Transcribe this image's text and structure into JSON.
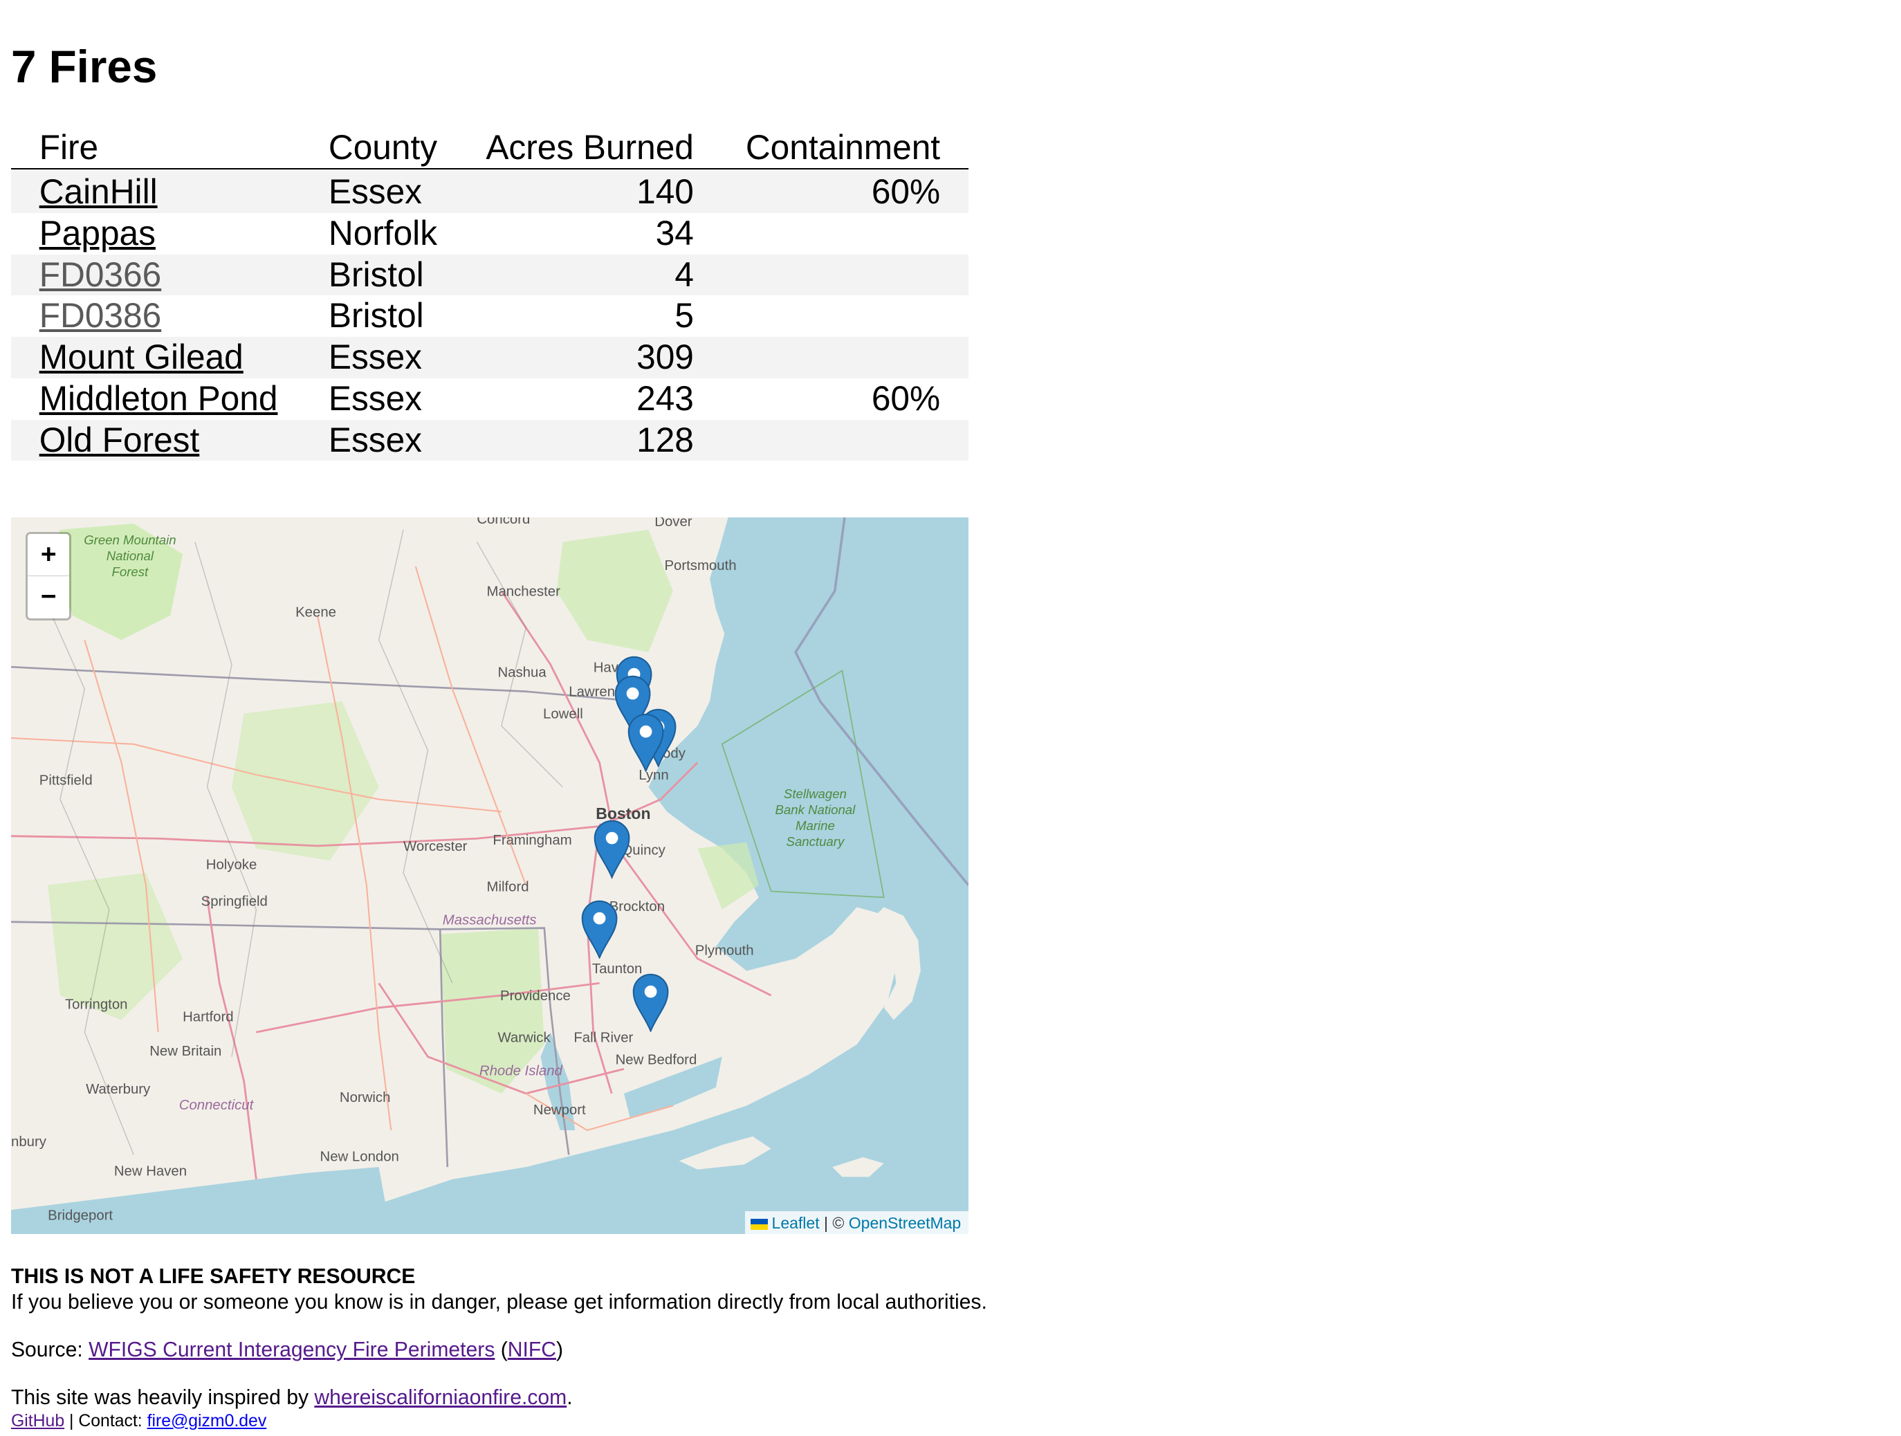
{
  "title": "7 Fires",
  "table": {
    "headers": {
      "fire": "Fire",
      "county": "County",
      "acres": "Acres Burned",
      "containment": "Containment"
    },
    "rows": [
      {
        "fire": "CainHill",
        "county": "Essex",
        "acres": "140",
        "containment": "60%"
      },
      {
        "fire": "Pappas",
        "county": "Norfolk",
        "acres": "34",
        "containment": ""
      },
      {
        "fire": "FD0366",
        "county": "Bristol",
        "acres": "4",
        "containment": ""
      },
      {
        "fire": "FD0386",
        "county": "Bristol",
        "acres": "5",
        "containment": ""
      },
      {
        "fire": "Mount Gilead",
        "county": "Essex",
        "acres": "309",
        "containment": ""
      },
      {
        "fire": "Middleton Pond",
        "county": "Essex",
        "acres": "243",
        "containment": "60%"
      },
      {
        "fire": "Old Forest",
        "county": "Essex",
        "acres": "128",
        "containment": ""
      }
    ]
  },
  "map": {
    "zoom_in": "+",
    "zoom_out": "−",
    "attribution": {
      "leaflet": "Leaflet",
      "separator": " | © ",
      "osm": "OpenStreetMap"
    },
    "colors": {
      "water": "#aad3df",
      "land": "#f2efe9",
      "park": "#cdebb0",
      "marker": "#2a81cb",
      "border": "#9e9cab",
      "road_major": "#e892a2"
    },
    "place_labels": {
      "concord": "Concord",
      "dover": "Dover",
      "portsmouth": "Portsmouth",
      "manchester": "Manchester",
      "keene": "Keene",
      "nashua": "Nashua",
      "haverhill": "Hav",
      "lawrence": "Lawren",
      "lowell": "Lowell",
      "peabody": "P   ody",
      "lynn": "Lynn",
      "boston": "Boston",
      "quincy": "Quincy",
      "framingham": "Framingham",
      "worcester": "Worcester",
      "pittsfield": "Pittsfield",
      "holyoke": "Holyoke",
      "springfield": "Springfield",
      "milford": "Milford",
      "massachusetts": "Massachusetts",
      "brockton": "Brockton",
      "plymouth": "Plymouth",
      "taunton": "Taunton",
      "providence": "Providence",
      "torrington": "Torrington",
      "hartford": "Hartford",
      "warwick": "Warwick",
      "fall_river": "Fall River",
      "new_bedford": "New Bedford",
      "new_britain": "New Britain",
      "rhode_island": "Rhode Island",
      "waterbury": "Waterbury",
      "norwich": "Norwich",
      "connecticut": "Connecticut",
      "newport": "Newport",
      "danbury": "nbury",
      "new_london": "New London",
      "new_haven": "New Haven",
      "bridgeport": "Bridgeport",
      "green_mountain": [
        "Green Mountain",
        "National",
        "Forest"
      ],
      "stellwagen": [
        "Stellwagen",
        "Bank National",
        "Marine",
        "Sanctuary"
      ]
    }
  },
  "footer": {
    "warning": "THIS IS NOT A LIFE SAFETY RESOURCE",
    "danger_text": "If you believe you or someone you know is in danger, please get information directly from local authorities.",
    "source_prefix": "Source: ",
    "source_link": "WFIGS Current Interagency Fire Perimeters",
    "source_paren_open": " (",
    "source_org": "NIFC",
    "source_paren_close": ")",
    "inspired_prefix": "This site was heavily inspired by ",
    "inspired_link": "whereiscaliforniaonfire.com",
    "inspired_suffix": ".",
    "github": "GitHub",
    "contact_prefix": " | Contact: ",
    "contact_email": "fire@gizm0.dev"
  }
}
